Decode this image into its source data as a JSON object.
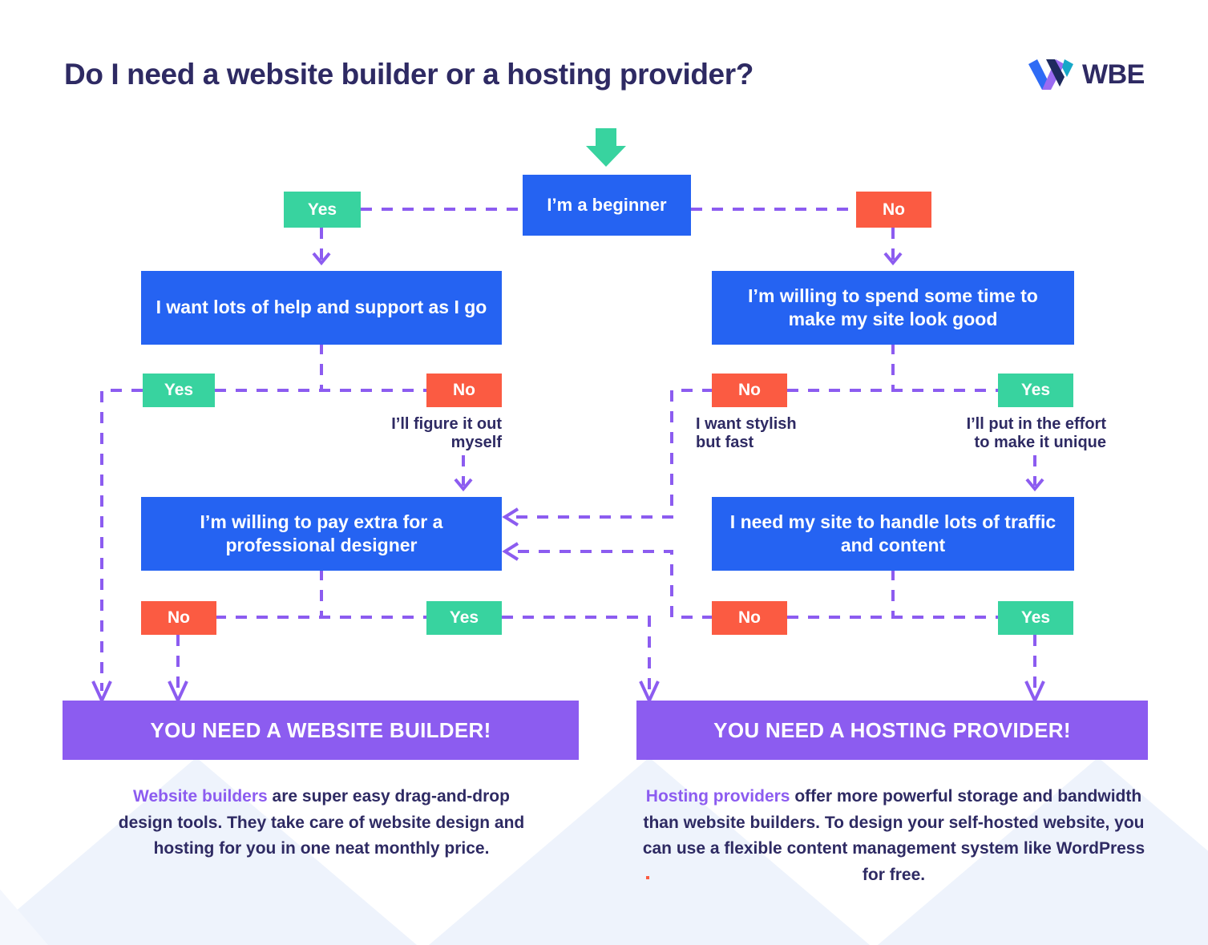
{
  "header": {
    "title": "Do I need a website builder or a hosting provider?",
    "logo_text": "WBE",
    "logo_mark_name": "wbe-chevron-logo"
  },
  "colors": {
    "question_blue": "#2563f2",
    "yes_green": "#38d39f",
    "no_red": "#fb5b42",
    "result_purple": "#8c5cf0",
    "connector_purple": "#8c5cf0",
    "text_navy": "#2e2a63",
    "background": "#ffffff",
    "watermark_blue": "#eef3fc"
  },
  "flow": {
    "start_arrow": "down-arrow",
    "nodes": [
      {
        "id": "q1",
        "type": "question",
        "text": "I’m a beginner"
      },
      {
        "id": "q2l",
        "type": "question",
        "text": "I want lots of help and support as I go"
      },
      {
        "id": "q2r",
        "type": "question",
        "text": "I’m willing to spend some time to make my site look good"
      },
      {
        "id": "q3l",
        "type": "question",
        "text": "I’m willing to pay extra for a professional designer"
      },
      {
        "id": "q3r",
        "type": "question",
        "text": "I need my site to handle lots of traffic and content"
      }
    ],
    "chips": [
      {
        "id": "c1-yes",
        "label": "Yes",
        "kind": "yes"
      },
      {
        "id": "c1-no",
        "label": "No",
        "kind": "no"
      },
      {
        "id": "c2-yes",
        "label": "Yes",
        "kind": "yes"
      },
      {
        "id": "c2-no",
        "label": "No",
        "kind": "no"
      },
      {
        "id": "c3-no",
        "label": "No",
        "kind": "no"
      },
      {
        "id": "c3-yes",
        "label": "Yes",
        "kind": "yes"
      },
      {
        "id": "c4-no",
        "label": "No",
        "kind": "no"
      },
      {
        "id": "c4-yes",
        "label": "Yes",
        "kind": "yes"
      },
      {
        "id": "c5-no",
        "label": "No",
        "kind": "no"
      },
      {
        "id": "c5-yes",
        "label": "Yes",
        "kind": "yes"
      }
    ],
    "annotations": [
      {
        "id": "a-left-no",
        "line1": "I’ll figure it out",
        "line2": "myself"
      },
      {
        "id": "a-right-no",
        "line1": "I want stylish",
        "line2": "but fast"
      },
      {
        "id": "a-right-yes",
        "line1": "I’ll put in the effort",
        "line2": "to make it unique"
      }
    ],
    "results": [
      {
        "id": "r-left",
        "text": "YOU NEED A WEBSITE BUILDER!"
      },
      {
        "id": "r-right",
        "text": "YOU NEED A HOSTING PROVIDER!"
      }
    ]
  },
  "blurbs": {
    "left": {
      "highlight": "Website builders",
      "rest": " are super easy drag-and-drop design tools. They take care of website design and hosting for you in one neat monthly price."
    },
    "right": {
      "highlight": "Hosting providers",
      "rest": " offer more powerful storage and bandwidth than website builders. To design your self-hosted website, you can use a flexible content management system like WordPress for free."
    }
  }
}
